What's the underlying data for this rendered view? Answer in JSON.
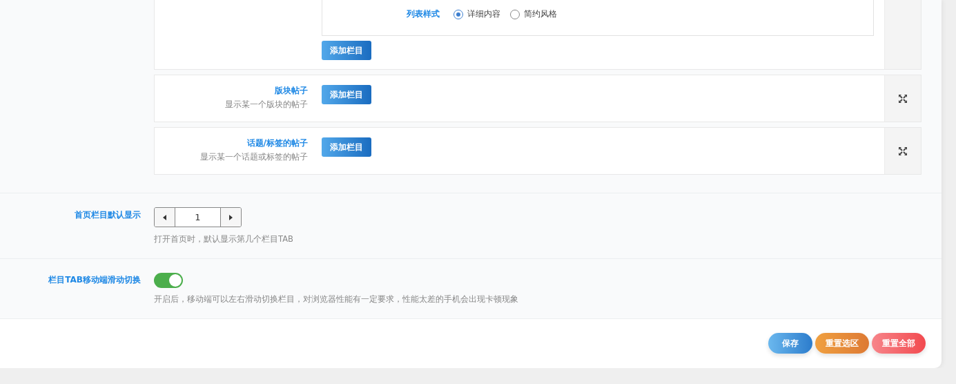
{
  "column_cards": [
    {
      "kind": "configured",
      "list_style": {
        "label": "列表样式",
        "options": [
          {
            "label": "详细内容",
            "selected": true
          },
          {
            "label": "简约风格",
            "selected": false
          }
        ]
      },
      "add_button": "添加栏目"
    },
    {
      "kind": "type",
      "title": "版块帖子",
      "description": "显示某一个版块的帖子",
      "add_button": "添加栏目"
    },
    {
      "kind": "type",
      "title": "话题/标签的帖子",
      "description": "显示某一个话题或标签的帖子",
      "add_button": "添加栏目"
    }
  ],
  "settings": [
    {
      "kind": "stepper",
      "label": "首页栏目默认显示",
      "value": "1",
      "hint": "打开首页时，默认显示第几个栏目TAB"
    },
    {
      "kind": "switch",
      "label": "栏目TAB移动端滑动切换",
      "on": true,
      "hint": "开启后，移动端可以左右滑动切换栏目，对浏览器性能有一定要求，性能太差的手机会出现卡顿现象"
    }
  ],
  "buttons": [
    {
      "kind": "save",
      "label": "保存"
    },
    {
      "kind": "reset_selection",
      "label": "重置选区"
    },
    {
      "kind": "reset_all",
      "label": "重置全部"
    }
  ]
}
